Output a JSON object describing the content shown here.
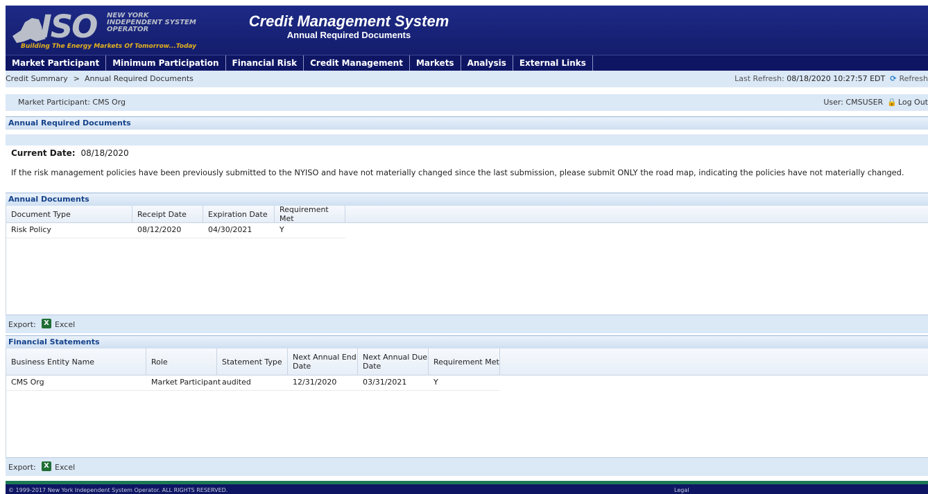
{
  "banner": {
    "logo_text": "ISO",
    "logo_top": "NEW YORK INDEPENDENT SYSTEM OPERATOR",
    "logo_tagline": "Building The Energy Markets Of Tomorrow...Today",
    "app_title": "Credit Management System",
    "page_subtitle": "Annual Required Documents"
  },
  "nav": [
    "Market Participant",
    "Minimum Participation",
    "Financial Risk",
    "Credit Management",
    "Markets",
    "Analysis",
    "External Links"
  ],
  "breadcrumb": {
    "parent": "Credit Summary",
    "separator": ">",
    "current": "Annual Required Documents"
  },
  "refresh": {
    "label": "Last Refresh:",
    "value": "08/18/2020 10:27:57 EDT",
    "button": "Refresh"
  },
  "participant": {
    "label": "Market Participant:",
    "value": "CMS Org"
  },
  "user": {
    "label": "User:",
    "value": "CMSUSER",
    "logout": "Log Out"
  },
  "section_title": "Annual Required Documents",
  "current_date": {
    "label": "Current Date:",
    "value": "08/18/2020"
  },
  "notice": "If the risk management policies have been previously submitted to the NYISO and have not materially changed since the last submission, please submit ONLY the road map, indicating the policies have not materially changed.",
  "annual_documents": {
    "title": "Annual Documents",
    "columns": [
      "Document Type",
      "Receipt Date",
      "Expiration Date",
      "Requirement Met"
    ],
    "rows": [
      [
        "Risk Policy",
        "08/12/2020",
        "04/30/2021",
        "Y"
      ]
    ]
  },
  "financial_statements": {
    "title": "Financial Statements",
    "columns": [
      "Business Entity Name",
      "Role",
      "Statement Type",
      "Next Annual End Date",
      "Next Annual Due Date",
      "Requirement Met"
    ],
    "rows": [
      [
        "CMS Org",
        "Market Participant",
        "audited",
        "12/31/2020",
        "03/31/2021",
        "Y"
      ]
    ]
  },
  "export": {
    "label": "Export:",
    "excel": "Excel"
  },
  "footer": {
    "copyright": "© 1999-2017 New York Independent System Operator. ALL RIGHTS RESERVED.",
    "legal": "Legal"
  },
  "colors": {
    "banner": "#1d2a86",
    "nav": "#0e1664",
    "panel": "#dbe8f6",
    "header_text": "#15428b",
    "footer_green": "#1c7a54"
  }
}
